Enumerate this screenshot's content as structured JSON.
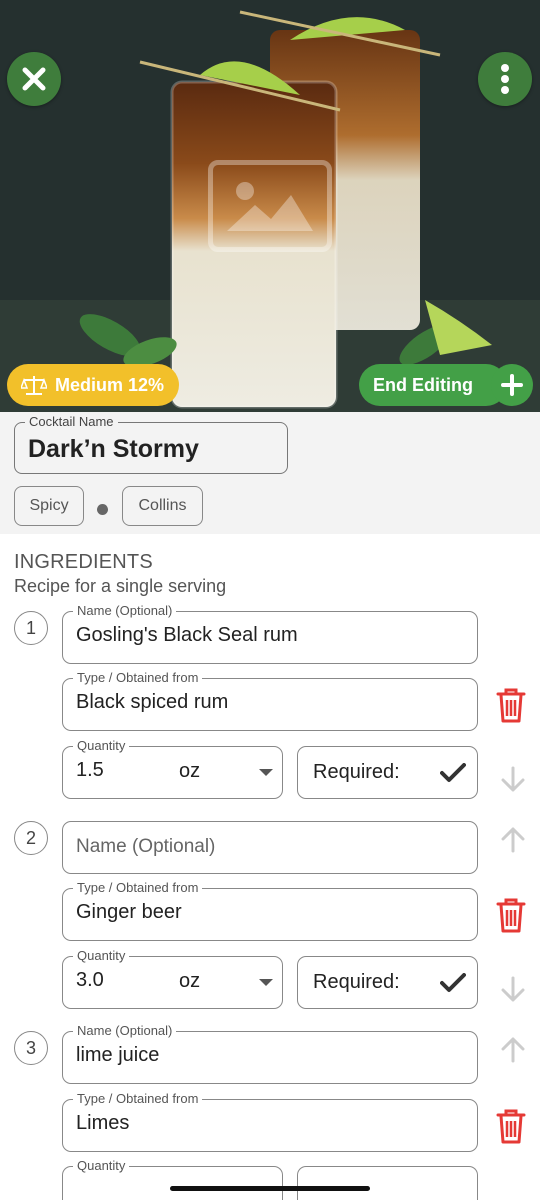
{
  "hero": {
    "strength_label": "Medium 12%",
    "end_editing_label": "End Editing",
    "icons": {
      "close": "close-icon",
      "menu": "more-vertical-icon",
      "image": "image-placeholder-icon",
      "strength": "scale-icon",
      "add": "plus-icon"
    },
    "colors": {
      "green_button": "#3f7d3c",
      "end_editing": "#43a047",
      "strength": "#f2c02a"
    }
  },
  "cocktail": {
    "name_label": "Cocktail Name",
    "name": "Dark’n Stormy",
    "tags": [
      "Spicy",
      "Collins"
    ]
  },
  "ingredients": {
    "title": "INGREDIENTS",
    "subtitle": "Recipe for a single serving",
    "labels": {
      "name": "Name (Optional)",
      "type": "Type / Obtained from",
      "quantity": "Quantity",
      "required": "Required:"
    },
    "items": [
      {
        "index": "1",
        "name": "Gosling's Black Seal rum",
        "type": "Black spiced rum",
        "quantity": "1.5",
        "unit": "oz",
        "required": true
      },
      {
        "index": "2",
        "name": "",
        "type": "Ginger beer",
        "quantity": "3.0",
        "unit": "oz",
        "required": true
      },
      {
        "index": "3",
        "name": "lime juice",
        "type": "Limes",
        "quantity": "",
        "unit": "",
        "required": true
      }
    ],
    "colors": {
      "delete": "#e53935",
      "arrow": "#cccccc"
    }
  }
}
